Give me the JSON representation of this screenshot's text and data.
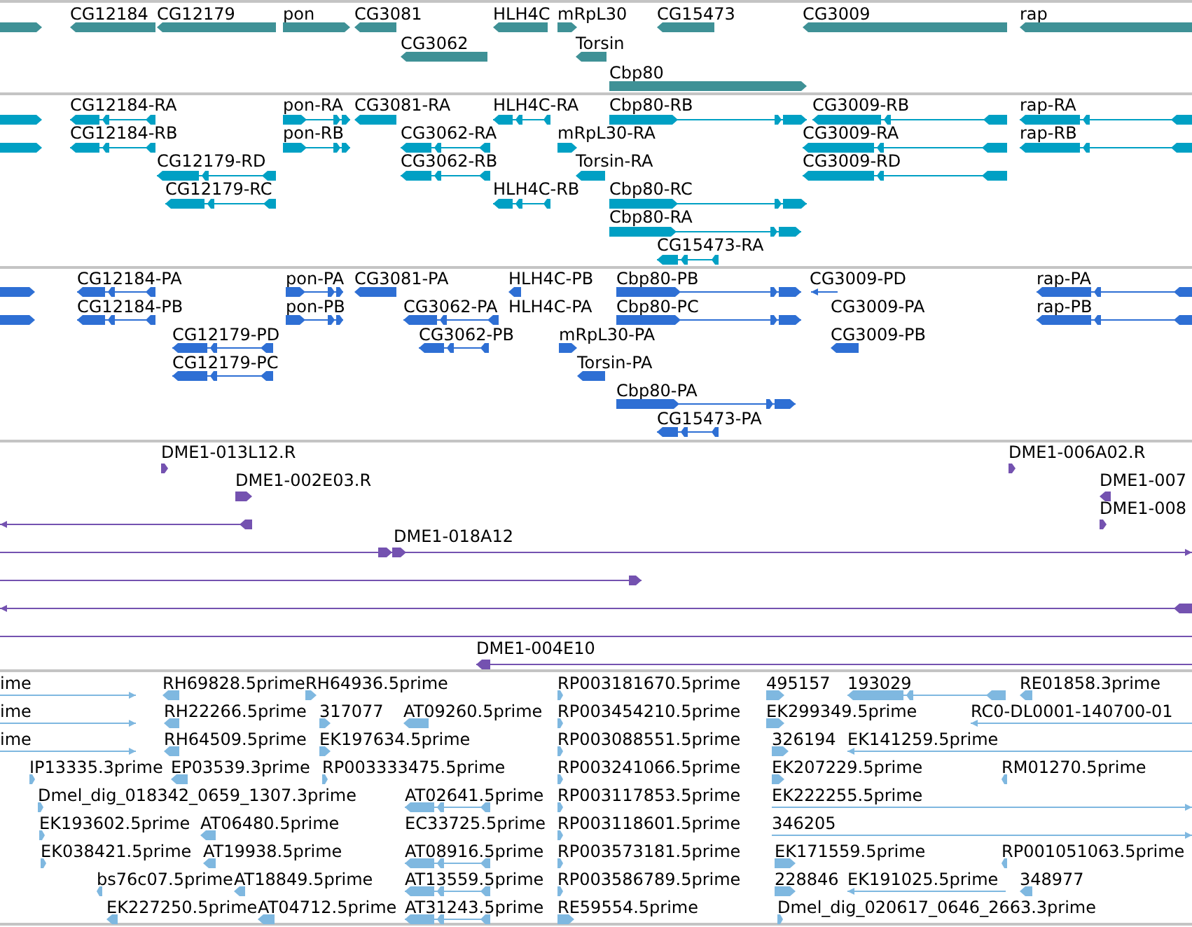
{
  "tracks": [
    {
      "color": "#3f9196",
      "features": [
        {
          "reverse": false,
          "kind": "block"
        },
        {
          "label": "CG12184",
          "reverse": true,
          "kind": "block"
        },
        {
          "label": "CG12179",
          "reverse": true,
          "kind": "block"
        },
        {
          "label": "pon",
          "reverse": false,
          "kind": "block"
        },
        {
          "label": "CG3081",
          "reverse": true,
          "kind": "block"
        },
        {
          "label": "HLH4C",
          "reverse": true,
          "kind": "block"
        },
        {
          "label": "mRpL30",
          "reverse": false,
          "kind": "block"
        },
        {
          "label": "CG15473",
          "reverse": true,
          "kind": "block"
        },
        {
          "label": "CG3009",
          "reverse": true,
          "kind": "block"
        },
        {
          "label": "rap",
          "reverse": true,
          "kind": "block"
        },
        {
          "label": "CG3062",
          "reverse": true,
          "kind": "block"
        },
        {
          "label": "Torsin",
          "reverse": true,
          "kind": "block"
        },
        {
          "label": "Cbp80",
          "reverse": false,
          "kind": "block"
        }
      ]
    },
    {
      "color": "#00a0c4",
      "features": [
        {
          "reverse": false,
          "kind": "block"
        },
        {
          "label": "CG12184-RA",
          "reverse": true,
          "kind": "spliced"
        },
        {
          "label": "pon-RA",
          "reverse": false,
          "kind": "spliced"
        },
        {
          "label": "CG3081-RA",
          "reverse": true,
          "kind": "block"
        },
        {
          "label": "HLH4C-RA",
          "reverse": true,
          "kind": "spliced"
        },
        {
          "label": "Cbp80-RB",
          "reverse": false,
          "kind": "spliced"
        },
        {
          "label": "CG3009-RB",
          "reverse": true,
          "kind": "spliced"
        },
        {
          "label": "rap-RA",
          "reverse": true,
          "kind": "spliced"
        },
        {
          "reverse": false,
          "kind": "block"
        },
        {
          "label": "CG12184-RB",
          "reverse": true,
          "kind": "spliced"
        },
        {
          "label": "pon-RB",
          "reverse": false,
          "kind": "spliced"
        },
        {
          "label": "CG3062-RA",
          "reverse": true,
          "kind": "spliced"
        },
        {
          "label": "mRpL30-RA",
          "reverse": false,
          "kind": "spliced"
        },
        {
          "label": "CG3009-RA",
          "reverse": true,
          "kind": "spliced"
        },
        {
          "label": "rap-RB",
          "reverse": true,
          "kind": "spliced"
        },
        {
          "label": "CG12179-RD",
          "reverse": true,
          "kind": "spliced"
        },
        {
          "label": "CG3062-RB",
          "reverse": true,
          "kind": "spliced"
        },
        {
          "label": "Torsin-RA",
          "reverse": true,
          "kind": "spliced"
        },
        {
          "label": "CG3009-RD",
          "reverse": true,
          "kind": "spliced"
        },
        {
          "label": "CG12179-RC",
          "reverse": true,
          "kind": "spliced"
        },
        {
          "label": "HLH4C-RB",
          "reverse": true,
          "kind": "spliced"
        },
        {
          "label": "Cbp80-RC",
          "reverse": false,
          "kind": "spliced"
        },
        {
          "label": "Cbp80-RA",
          "reverse": false,
          "kind": "spliced"
        },
        {
          "label": "CG15473-RA",
          "reverse": true,
          "kind": "spliced"
        }
      ]
    },
    {
      "color": "#2e6fd4",
      "features": [
        {
          "reverse": false,
          "kind": "block"
        },
        {
          "label": "CG12184-PA",
          "reverse": true,
          "kind": "spliced"
        },
        {
          "label": "pon-PA",
          "reverse": false,
          "kind": "spliced"
        },
        {
          "label": "CG3081-PA",
          "reverse": true,
          "kind": "block"
        },
        {
          "label": "HLH4C-PB",
          "reverse": true,
          "kind": "block"
        },
        {
          "label": "Cbp80-PB",
          "reverse": false,
          "kind": "spliced"
        },
        {
          "label": "CG3009-PD",
          "reverse": true,
          "kind": "line"
        },
        {
          "label": "rap-PA",
          "reverse": true,
          "kind": "spliced"
        },
        {
          "reverse": false,
          "kind": "block"
        },
        {
          "label": "CG12184-PB",
          "reverse": true,
          "kind": "spliced"
        },
        {
          "label": "pon-PB",
          "reverse": false,
          "kind": "spliced"
        },
        {
          "label": "CG3062-PA",
          "reverse": true,
          "kind": "spliced"
        },
        {
          "label": "HLH4C-PA"
        },
        {
          "label": "Cbp80-PC",
          "reverse": false,
          "kind": "spliced"
        },
        {
          "label": "CG3009-PA"
        },
        {
          "label": "rap-PB",
          "reverse": true,
          "kind": "spliced"
        },
        {
          "label": "CG12179-PD",
          "reverse": true,
          "kind": "spliced"
        },
        {
          "label": "CG3062-PB",
          "reverse": true,
          "kind": "spliced"
        },
        {
          "label": "mRpL30-PA",
          "reverse": false,
          "kind": "spliced"
        },
        {
          "label": "CG3009-PB",
          "reverse": true,
          "kind": "block"
        },
        {
          "label": "CG12179-PC",
          "reverse": true,
          "kind": "spliced"
        },
        {
          "label": "Torsin-PA",
          "reverse": true,
          "kind": "spliced"
        },
        {
          "label": "Cbp80-PA",
          "reverse": false,
          "kind": "spliced"
        },
        {
          "label": "CG15473-PA",
          "reverse": true,
          "kind": "spliced"
        }
      ]
    },
    {
      "color": "#7452b0",
      "features": [
        {
          "label": "DME1-013L12.R",
          "reverse": false,
          "kind": "block"
        },
        {
          "label": "DME1-006A02.R",
          "reverse": false,
          "kind": "block"
        },
        {
          "label": "DME1-002E03.R",
          "reverse": false,
          "kind": "block"
        },
        {
          "label": "DME1-007",
          "reverse": true,
          "kind": "block"
        },
        {
          "reverse": true,
          "kind": "line"
        },
        {
          "label": "DME1-008",
          "reverse": false,
          "kind": "block"
        },
        {
          "label": "DME1-018A12",
          "reverse": false,
          "kind": "line"
        },
        {
          "reverse": false,
          "kind": "line"
        },
        {
          "reverse": true,
          "kind": "line"
        },
        {
          "kind": "line"
        },
        {
          "label": "DME1-004E10",
          "reverse": true,
          "kind": "line"
        }
      ]
    },
    {
      "color": "#7fb8e0",
      "features": [
        {
          "label": "ime",
          "reverse": false,
          "kind": "line"
        },
        {
          "label": "RH69828.5prime",
          "reverse": true,
          "kind": "block"
        },
        {
          "label": "RH64936.5prime",
          "reverse": false,
          "kind": "block"
        },
        {
          "label": "RP003181670.5prime",
          "reverse": false,
          "kind": "block"
        },
        {
          "label": "495157",
          "reverse": false,
          "kind": "spliced"
        },
        {
          "label": "193029",
          "reverse": true,
          "kind": "spliced"
        },
        {
          "label": "RE01858.3prime",
          "reverse": true,
          "kind": "block"
        },
        {
          "label": "ime",
          "reverse": false,
          "kind": "line"
        },
        {
          "label": "RH22266.5prime",
          "reverse": true,
          "kind": "block"
        },
        {
          "label": "317077",
          "reverse": false,
          "kind": "block"
        },
        {
          "label": "AT09260.5prime",
          "reverse": true,
          "kind": "spliced"
        },
        {
          "label": "RP003454210.5prime",
          "reverse": false,
          "kind": "block"
        },
        {
          "label": "EK299349.5prime",
          "reverse": false,
          "kind": "spliced"
        },
        {
          "label": "RC0-DL0001-140700-01",
          "reverse": true,
          "kind": "line"
        },
        {
          "label": "ime",
          "reverse": false,
          "kind": "line"
        },
        {
          "label": "RH64509.5prime",
          "reverse": true,
          "kind": "block"
        },
        {
          "label": "EK197634.5prime",
          "reverse": false,
          "kind": "block"
        },
        {
          "label": "RP003088551.5prime",
          "reverse": false,
          "kind": "block"
        },
        {
          "label": "326194",
          "reverse": false,
          "kind": "spliced"
        },
        {
          "label": "EK141259.5prime",
          "reverse": true,
          "kind": "line"
        },
        {
          "label": "IP13335.3prime",
          "reverse": false,
          "kind": "block"
        },
        {
          "label": "EP03539.3prime",
          "reverse": true,
          "kind": "spliced"
        },
        {
          "label": "RP003333475.5prime",
          "reverse": false,
          "kind": "block"
        },
        {
          "label": "RP003241066.5prime",
          "reverse": false,
          "kind": "block"
        },
        {
          "label": "EK207229.5prime",
          "reverse": false,
          "kind": "block"
        },
        {
          "label": "RM01270.5prime",
          "reverse": true,
          "kind": "block"
        },
        {
          "label": "Dmel_dig_018342_0659_1307.3prime",
          "reverse": false,
          "kind": "block"
        },
        {
          "label": "AT02641.5prime",
          "reverse": true,
          "kind": "spliced"
        },
        {
          "label": "RP003117853.5prime",
          "reverse": false,
          "kind": "block"
        },
        {
          "label": "EK222255.5prime",
          "reverse": false,
          "kind": "line"
        },
        {
          "label": "EK193602.5prime",
          "reverse": false,
          "kind": "block"
        },
        {
          "label": "AT06480.5prime",
          "reverse": true,
          "kind": "block"
        },
        {
          "label": "EC33725.5prime"
        },
        {
          "label": "RP003118601.5prime",
          "reverse": false,
          "kind": "block"
        },
        {
          "label": "346205",
          "reverse": false,
          "kind": "line"
        },
        {
          "label": "EK038421.5prime",
          "reverse": false,
          "kind": "block"
        },
        {
          "label": "AT19938.5prime",
          "reverse": true,
          "kind": "block"
        },
        {
          "label": "AT08916.5prime",
          "reverse": true,
          "kind": "spliced"
        },
        {
          "label": "RP003573181.5prime",
          "reverse": false,
          "kind": "block"
        },
        {
          "label": "EK171559.5prime",
          "reverse": false,
          "kind": "spliced"
        },
        {
          "label": "RP001051063.5prime",
          "reverse": true,
          "kind": "block"
        },
        {
          "label": "bs76c07.5prime",
          "reverse": true,
          "kind": "block"
        },
        {
          "label": "AT18849.5prime",
          "reverse": true,
          "kind": "block"
        },
        {
          "label": "AT13559.5prime",
          "reverse": true,
          "kind": "spliced"
        },
        {
          "label": "RP003586789.5prime",
          "reverse": false,
          "kind": "block"
        },
        {
          "label": "228846",
          "reverse": false,
          "kind": "spliced"
        },
        {
          "label": "EK191025.5prime",
          "reverse": true,
          "kind": "line"
        },
        {
          "label": "348977",
          "reverse": true,
          "kind": "block"
        },
        {
          "label": "EK227250.5prime",
          "reverse": true,
          "kind": "block"
        },
        {
          "label": "AT04712.5prime",
          "reverse": true,
          "kind": "block"
        },
        {
          "label": "AT31243.5prime",
          "reverse": true,
          "kind": "spliced"
        },
        {
          "label": "RE59554.5prime",
          "reverse": false,
          "kind": "spliced"
        },
        {
          "label": "Dmel_dig_020617_0646_2663.3prime",
          "reverse": false,
          "kind": "block"
        }
      ]
    }
  ]
}
